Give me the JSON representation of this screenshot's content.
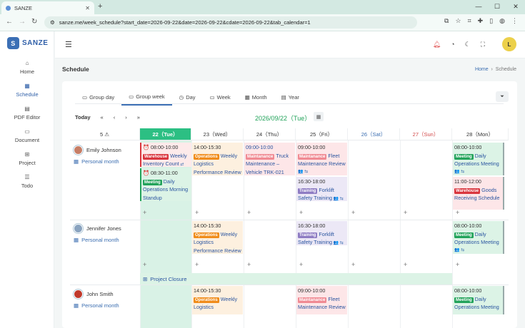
{
  "browser": {
    "tab_title": "SANZE",
    "url": "sanze.me/week_schedule?start_date=2026-09-22&date=2026-09-22&cdate=2026-09-22&tab_calendar=1"
  },
  "app": {
    "logo": "SANZE",
    "avatar_letter": "L"
  },
  "sidebar": {
    "items": [
      {
        "label": "Home",
        "icon": "home-icon"
      },
      {
        "label": "Schedule",
        "icon": "calendar-icon"
      },
      {
        "label": "PDF Editor",
        "icon": "pdf-icon"
      },
      {
        "label": "Document",
        "icon": "folder-icon"
      },
      {
        "label": "Project",
        "icon": "project-icon"
      },
      {
        "label": "Todo",
        "icon": "todo-icon"
      }
    ]
  },
  "page": {
    "title": "Schedule",
    "breadcrumb_home": "Home",
    "breadcrumb_current": "Schedule"
  },
  "view_tabs": [
    "Group day",
    "Group week",
    "Day",
    "Week",
    "Month",
    "Year"
  ],
  "nav": {
    "today": "Today",
    "prev2": "«",
    "prev": "‹",
    "next": "›",
    "next2": "»",
    "current_date": "2026/09/22（Tue）"
  },
  "header": {
    "corner": "5 ⚠",
    "days": [
      "22（Tue）",
      "23（Wed）",
      "24（Thu）",
      "25（Fri）",
      "26（Sat）",
      "27（Sun）",
      "28（Mon）"
    ]
  },
  "people": [
    {
      "name": "Emily Johnson",
      "calendar": "Personal month"
    },
    {
      "name": "Jennifer Jones",
      "calendar": "Personal month"
    },
    {
      "name": "John Smith",
      "calendar": "Personal month"
    }
  ],
  "events": [
    {
      "id": "e1",
      "time": "08:00-10:00",
      "tag": "Warehouse",
      "title": "Weekly Inventory Count"
    },
    {
      "id": "e2",
      "time": "08:30-11:00",
      "tag": "Meeting",
      "title": "Daily Operations Morning Standup"
    },
    {
      "id": "e3",
      "time": "14:00-15:30",
      "tag": "Operations",
      "title": "Weekly Logistics Performance Review"
    },
    {
      "id": "e4",
      "time": "09:00-10:00",
      "tag": "Maintanance",
      "title": "Truck Maintenance – Vehicle TRK-021"
    },
    {
      "id": "e5",
      "time": "09:00-10:00",
      "tag": "Maintanance",
      "title": "Fleet Maintenance Review"
    },
    {
      "id": "e6",
      "time": "16:30-18:00",
      "tag": "Training",
      "title": "Forklift Safety Training"
    },
    {
      "id": "e7",
      "time": "08:00-10:00",
      "tag": "Meeting",
      "title": "Daily Operations Meeting"
    },
    {
      "id": "e8",
      "time": "11:00-12:00",
      "tag": "Warehouse",
      "title": "Goods Receiving Schedule"
    },
    {
      "id": "e9",
      "time": "14:00-15:30",
      "tag": "Operations",
      "title": "Weekly Logistics Performance Review"
    },
    {
      "id": "e10",
      "time": "16:30-18:00",
      "tag": "Training",
      "title": "Forklift Safety Training"
    },
    {
      "id": "e11",
      "time": "08:00-10:00",
      "tag": "Meeting",
      "title": "Daily Operations Meeting"
    },
    {
      "id": "e12",
      "time": "14:00-15:30",
      "tag": "Operations",
      "title": "Weekly Logistics"
    },
    {
      "id": "e13",
      "time": "09:00-10:00",
      "tag": "Maintanance",
      "title": "Fleet Maintenance Review"
    },
    {
      "id": "e14",
      "time": "08:00-10:00",
      "tag": "Meeting",
      "title": "Daily Operations Meeting"
    }
  ],
  "project_bar": {
    "label": "Project Closure"
  },
  "colors": {
    "Warehouse": "#d9363e",
    "Meeting": "#22a35a",
    "Operations": "#f08c1a",
    "Maintanance": "#f08a93",
    "Training": "#8e7cc3"
  }
}
